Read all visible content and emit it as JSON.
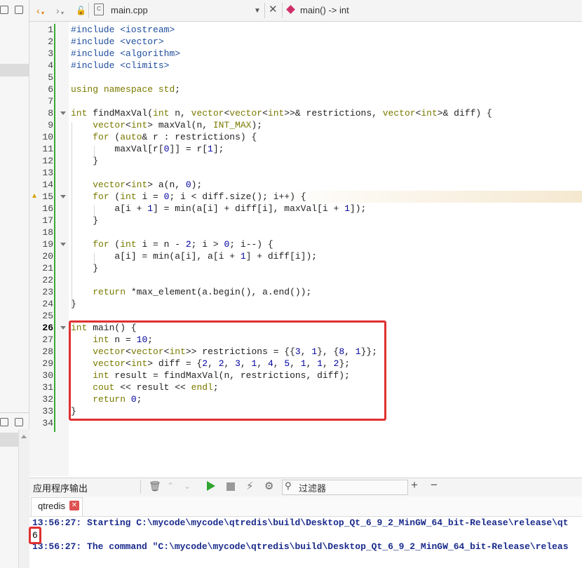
{
  "toolbar": {
    "file_name": "main.cpp",
    "function_scope": "main() -> int"
  },
  "editor": {
    "line_numbers": [
      "1",
      "2",
      "3",
      "4",
      "5",
      "6",
      "7",
      "8",
      "9",
      "10",
      "11",
      "12",
      "13",
      "14",
      "15",
      "16",
      "17",
      "18",
      "19",
      "20",
      "21",
      "22",
      "23",
      "24",
      "25",
      "26",
      "27",
      "28",
      "29",
      "30",
      "31",
      "32",
      "33",
      "34"
    ],
    "current_line": "26",
    "lines": [
      "#include <iostream>",
      "#include <vector>",
      "#include <algorithm>",
      "#include <climits>",
      "",
      "using namespace std;",
      "",
      "int findMaxVal(int n, vector<vector<int>>& restrictions, vector<int>& diff) {",
      "    vector<int> maxVal(n, INT_MAX);",
      "    for (auto& r : restrictions) {",
      "        maxVal[r[0]] = r[1];",
      "    }",
      "",
      "    vector<int> a(n, 0);",
      "    for (int i = 0; i < diff.size(); i++) {",
      "        a[i + 1] = min(a[i] + diff[i], maxVal[i + 1]);",
      "    }",
      "",
      "    for (int i = n - 2; i > 0; i--) {",
      "        a[i] = min(a[i], a[i + 1] + diff[i]);",
      "    }",
      "",
      "    return *max_element(a.begin(), a.end());",
      "}",
      "",
      "int main() {",
      "    int n = 10;",
      "    vector<vector<int>> restrictions = {{3, 1}, {8, 1}};",
      "    vector<int> diff = {2, 2, 3, 1, 4, 5, 1, 1, 2};",
      "    int result = findMaxVal(n, restrictions, diff);",
      "    cout << result << endl;",
      "    return 0;",
      "}",
      ""
    ]
  },
  "output": {
    "pane_title": "应用程序输出",
    "filter_placeholder": "过滤器",
    "tab_label": "qtredis",
    "lines": [
      "13:56:27: Starting C:\\mycode\\mycode\\qtredis\\build\\Desktop_Qt_6_9_2_MinGW_64_bit-Release\\release\\qt",
      "13:56:27: The command \"C:\\mycode\\mycode\\qtredis\\build\\Desktop_Qt_6_9_2_MinGW_64_bit-Release\\releas"
    ],
    "result": "6"
  },
  "colors": {
    "highlight_border": "#e03030",
    "gutter_change_bar": "#3aa935",
    "output_text": "#1a2b8c"
  }
}
